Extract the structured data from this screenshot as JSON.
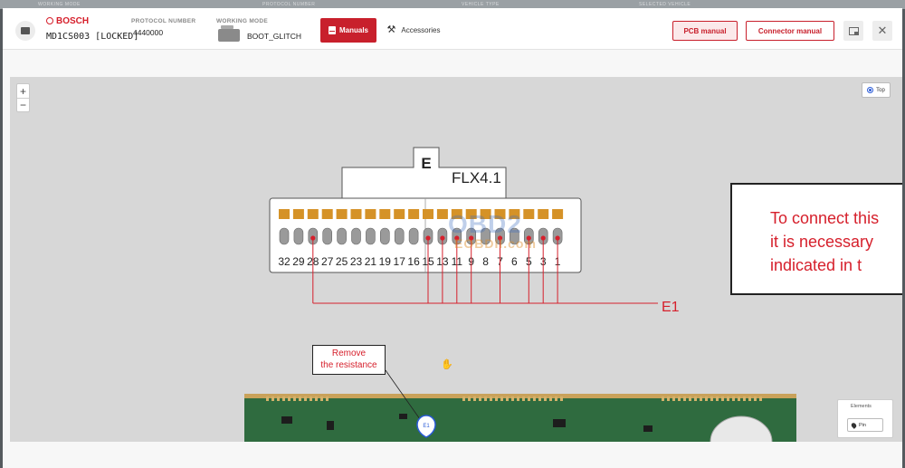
{
  "ghost_header": [
    "WORKING MODE",
    "PROTOCOL NUMBER",
    "VEHICLE TYPE",
    "SELECTED VEHICLE"
  ],
  "header": {
    "brand": "BOSCH",
    "ecu_name": "MD1CS003 [LOCKED]",
    "protocol_label": "PROTOCOL NUMBER",
    "protocol_value": "4440000",
    "mode_label": "WORKING MODE",
    "mode_value": "BOOT_GLITCH",
    "tab_manuals": "Manuals",
    "tab_accessories": "Accessories",
    "pcb_manual": "PCB manual",
    "connector_manual": "Connector manual",
    "close_glyph": "✕"
  },
  "viewer": {
    "zoom_in": "+",
    "zoom_out": "−",
    "view_toggle": "Top",
    "connector_letter": "E",
    "connector_name": "FLX4.1",
    "pin_numbers": [
      "32",
      "29",
      "28",
      "27",
      "25",
      "23",
      "21",
      "19",
      "17",
      "16",
      "15",
      "13",
      "11",
      "9",
      "8",
      "7",
      "6",
      "5",
      "3",
      "1"
    ],
    "marked_pins": [
      "28",
      "15",
      "13",
      "11",
      "9",
      "7",
      "5",
      "3",
      "1"
    ],
    "group_label": "E1",
    "instruction_lines": [
      "To connect this",
      "it is necessary",
      "indicated in t"
    ],
    "remove_note": [
      "Remove",
      "the resistance"
    ],
    "marker_label": "E1",
    "elements_title": "Elements",
    "elements_item": "Pin",
    "watermark_main": "OBD2",
    "watermark_sub": "EOBDII.com"
  },
  "colors": {
    "accent": "#c8202c",
    "pin_pad": "#d59227",
    "signal_line": "#d6202c",
    "pcb_green": "#2f6b3f"
  }
}
